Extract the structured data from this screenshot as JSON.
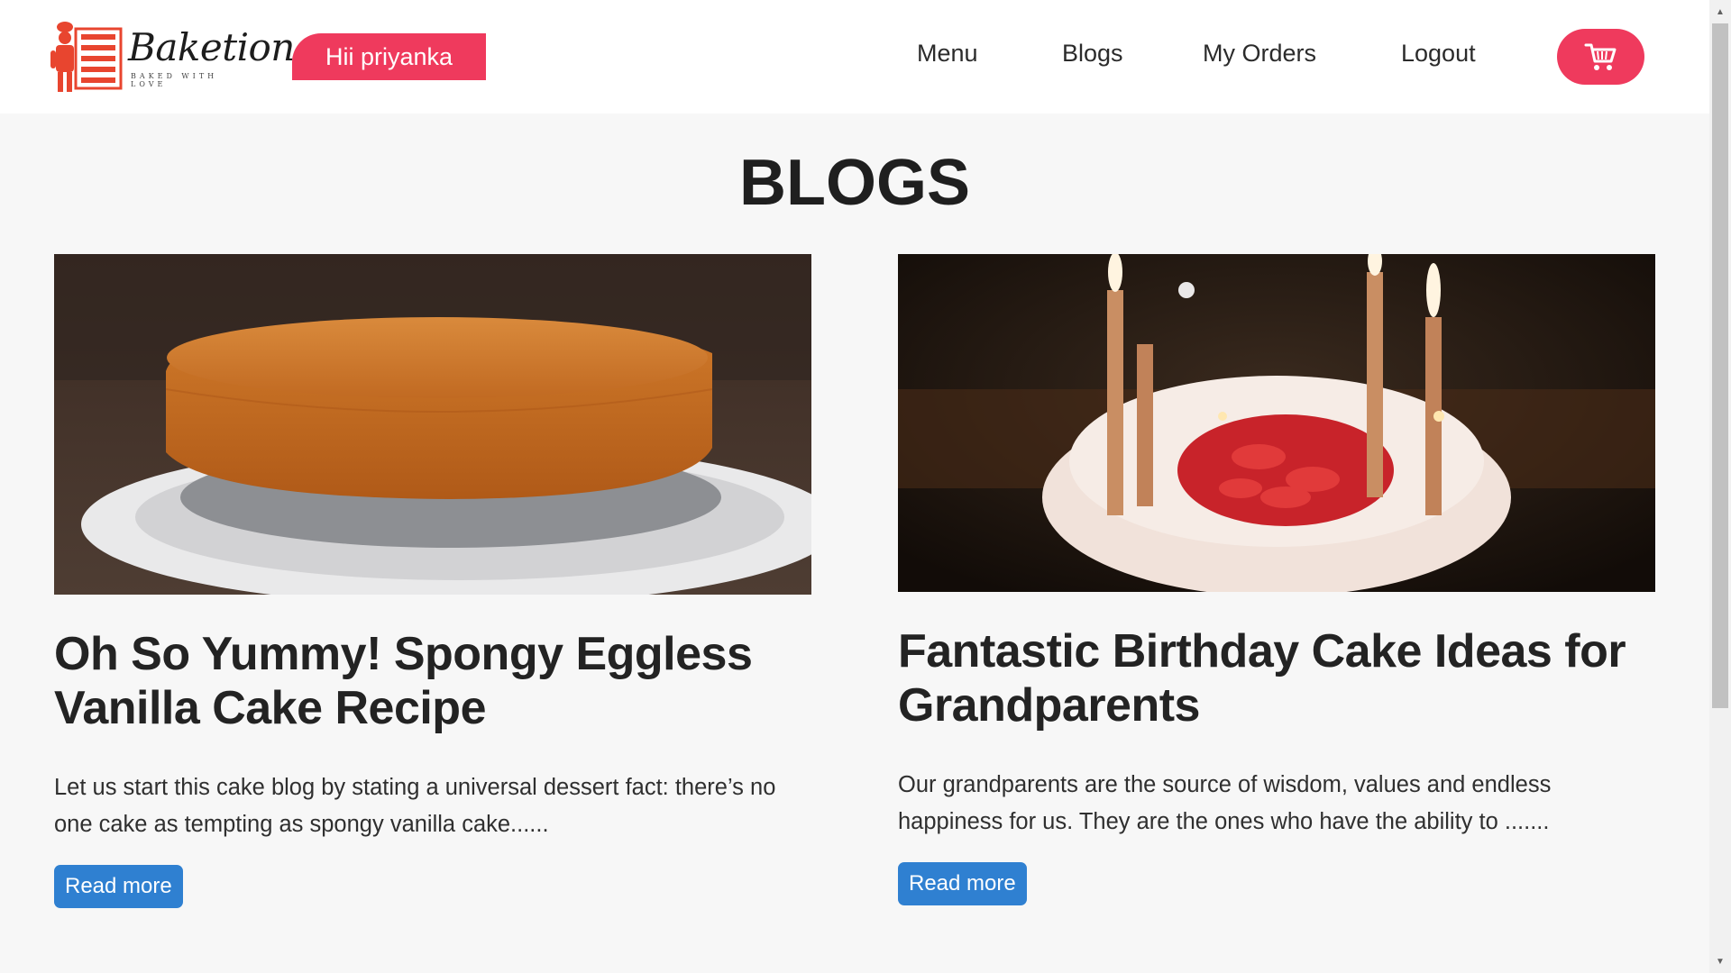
{
  "brand": {
    "name": "Baketion",
    "tagline": "BAKED WITH LOVE"
  },
  "header": {
    "greeting": "Hii priyanka",
    "nav": [
      {
        "label": "Menu"
      },
      {
        "label": "Blogs"
      },
      {
        "label": "My Orders"
      },
      {
        "label": "Logout"
      }
    ],
    "cart_icon": "cart-icon"
  },
  "page": {
    "title": "BLOGS"
  },
  "blogs": [
    {
      "title": "Oh So Yummy! Spongy Eggless Vanilla Cake Recipe",
      "excerpt": "Let us start this cake blog by stating a universal dessert fact: there’s no one cake as tempting as spongy vanilla cake......",
      "button": "Read more"
    },
    {
      "title": "Fantastic Birthday Cake Ideas for Grandparents",
      "excerpt": "Our grandparents are the source of wisdom, values and endless happiness for us. They are the ones who have the ability to .......",
      "button": "Read more"
    }
  ],
  "colors": {
    "accent": "#ef3a5d",
    "button": "#2f80d1",
    "background": "#f7f7f7"
  }
}
